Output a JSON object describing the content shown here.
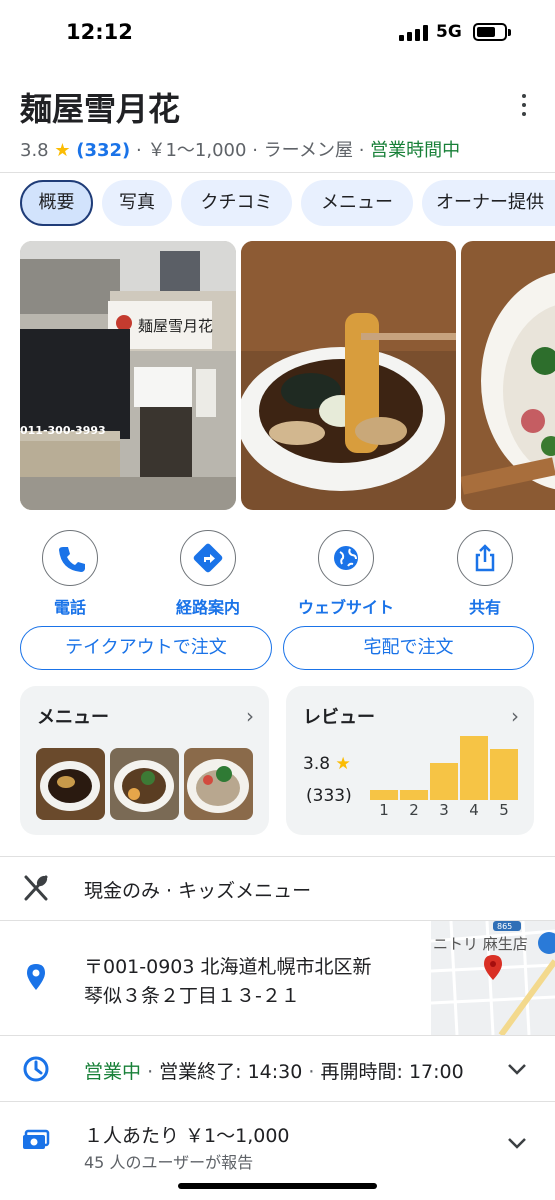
{
  "status": {
    "time": "12:12",
    "network": "5G"
  },
  "place": {
    "name": "麺屋雪月花",
    "rating": "3.8",
    "star": "★",
    "review_count": "(332)",
    "sep": "·",
    "price": "￥1〜1,000",
    "category": "ラーメン屋",
    "open_status": "営業時間中"
  },
  "tabs": [
    {
      "label": "概要"
    },
    {
      "label": "写真"
    },
    {
      "label": "クチコミ"
    },
    {
      "label": "メニュー"
    },
    {
      "label": "オーナー提供"
    }
  ],
  "storefront_photo": {
    "sign": "麺屋雪月花",
    "phone": "011-300-3993"
  },
  "actions": [
    {
      "label": "電話",
      "icon": "phone-icon"
    },
    {
      "label": "経路案内",
      "icon": "directions-icon"
    },
    {
      "label": "ウェブサイト",
      "icon": "globe-icon"
    },
    {
      "label": "共有",
      "icon": "share-icon"
    }
  ],
  "order_buttons": {
    "takeout": "テイクアウトで注文",
    "delivery": "宅配で注文"
  },
  "menu_card": {
    "title": "メニュー",
    "chevron": "›"
  },
  "review_card": {
    "title": "レビュー",
    "chevron": "›",
    "rating": "3.8",
    "star": "★",
    "count": "(333)",
    "distribution": [
      {
        "stars": "1",
        "value": 0.16
      },
      {
        "stars": "2",
        "value": 0.16
      },
      {
        "stars": "3",
        "value": 0.58
      },
      {
        "stars": "4",
        "value": 1.0
      },
      {
        "stars": "5",
        "value": 0.79
      }
    ]
  },
  "attributes": {
    "text": "現金のみ · キッズメニュー",
    "icon": "fork-knife-icon"
  },
  "address": {
    "line1": "〒001-0903 北海道札幌市北区新",
    "line2": "琴似３条２丁目１３-２１",
    "icon": "location-pin-icon"
  },
  "map": {
    "label": "ニトリ 麻生店",
    "route_badge": "865"
  },
  "hours": {
    "open": "営業中",
    "sep": "·",
    "closing": "営業終了: 14:30",
    "reopen": "再開時間: 17:00",
    "icon": "clock-icon"
  },
  "price_info": {
    "main": "１人あたり ￥1〜1,000",
    "sub": "45 人のユーザーが報告",
    "icon": "money-icon"
  },
  "colors": {
    "accent": "#1a73e8",
    "open": "#188038",
    "star": "#fbbc04",
    "bar": "#f6c445",
    "pin": "#d93025"
  }
}
